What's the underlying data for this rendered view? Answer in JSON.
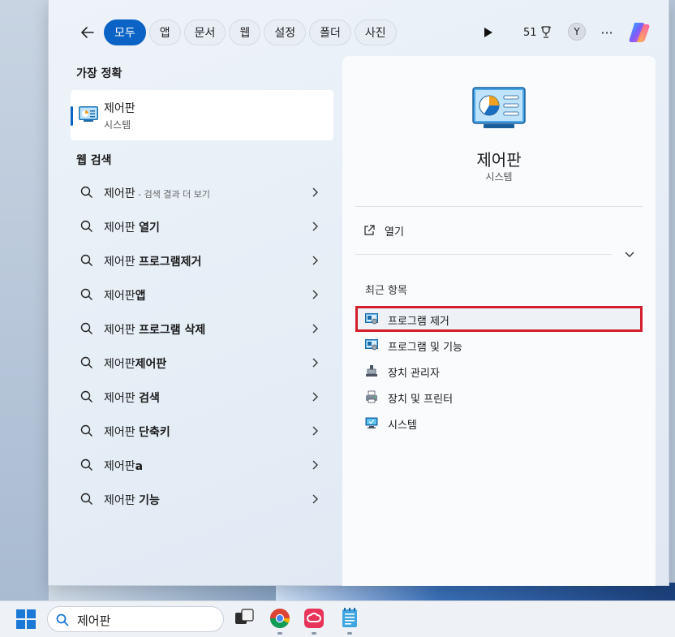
{
  "filter_bar": {
    "chips": [
      "모두",
      "앱",
      "문서",
      "웹",
      "설정",
      "폴더",
      "사진"
    ],
    "active_chip": "모두",
    "rewards_points": "51",
    "avatar_initial": "Y",
    "more_label": "···"
  },
  "best_match": {
    "section_title": "가장 정확",
    "title": "제어판",
    "subtitle": "시스템"
  },
  "web_search": {
    "section_title": "웹 검색",
    "items": [
      {
        "query": "제어판",
        "hint": " - 검색 결과 더 보기",
        "bold": ""
      },
      {
        "query": "제어판 ",
        "hint": "",
        "bold": "열기"
      },
      {
        "query": "제어판 ",
        "hint": "",
        "bold": "프로그램제거"
      },
      {
        "query": "제어판",
        "hint": "",
        "bold": "앱"
      },
      {
        "query": "제어판 ",
        "hint": "",
        "bold": "프로그램 삭제"
      },
      {
        "query": "제어판",
        "hint": "",
        "bold": "제어판"
      },
      {
        "query": "제어판 ",
        "hint": "",
        "bold": "검색"
      },
      {
        "query": "제어판 ",
        "hint": "",
        "bold": "단축키"
      },
      {
        "query": "제어판",
        "hint": "",
        "bold": "a"
      },
      {
        "query": "제어판 ",
        "hint": "",
        "bold": "기능"
      }
    ]
  },
  "preview": {
    "app_name": "제어판",
    "app_type": "시스템",
    "open_label": "열기",
    "recent_title": "최근 항목",
    "recent_items": [
      {
        "label": "프로그램 제거",
        "icon": "programs-icon",
        "highlighted": true
      },
      {
        "label": "프로그램 및 기능",
        "icon": "programs-icon",
        "highlighted": false
      },
      {
        "label": "장치 관리자",
        "icon": "device-manager-icon",
        "highlighted": false
      },
      {
        "label": "장치 및 프린터",
        "icon": "printer-icon",
        "highlighted": false
      },
      {
        "label": "시스템",
        "icon": "system-icon",
        "highlighted": false
      }
    ]
  },
  "taskbar": {
    "search_value": "제어판"
  },
  "colors": {
    "accent": "#0b63c5",
    "highlight_border": "#d21f2b"
  }
}
